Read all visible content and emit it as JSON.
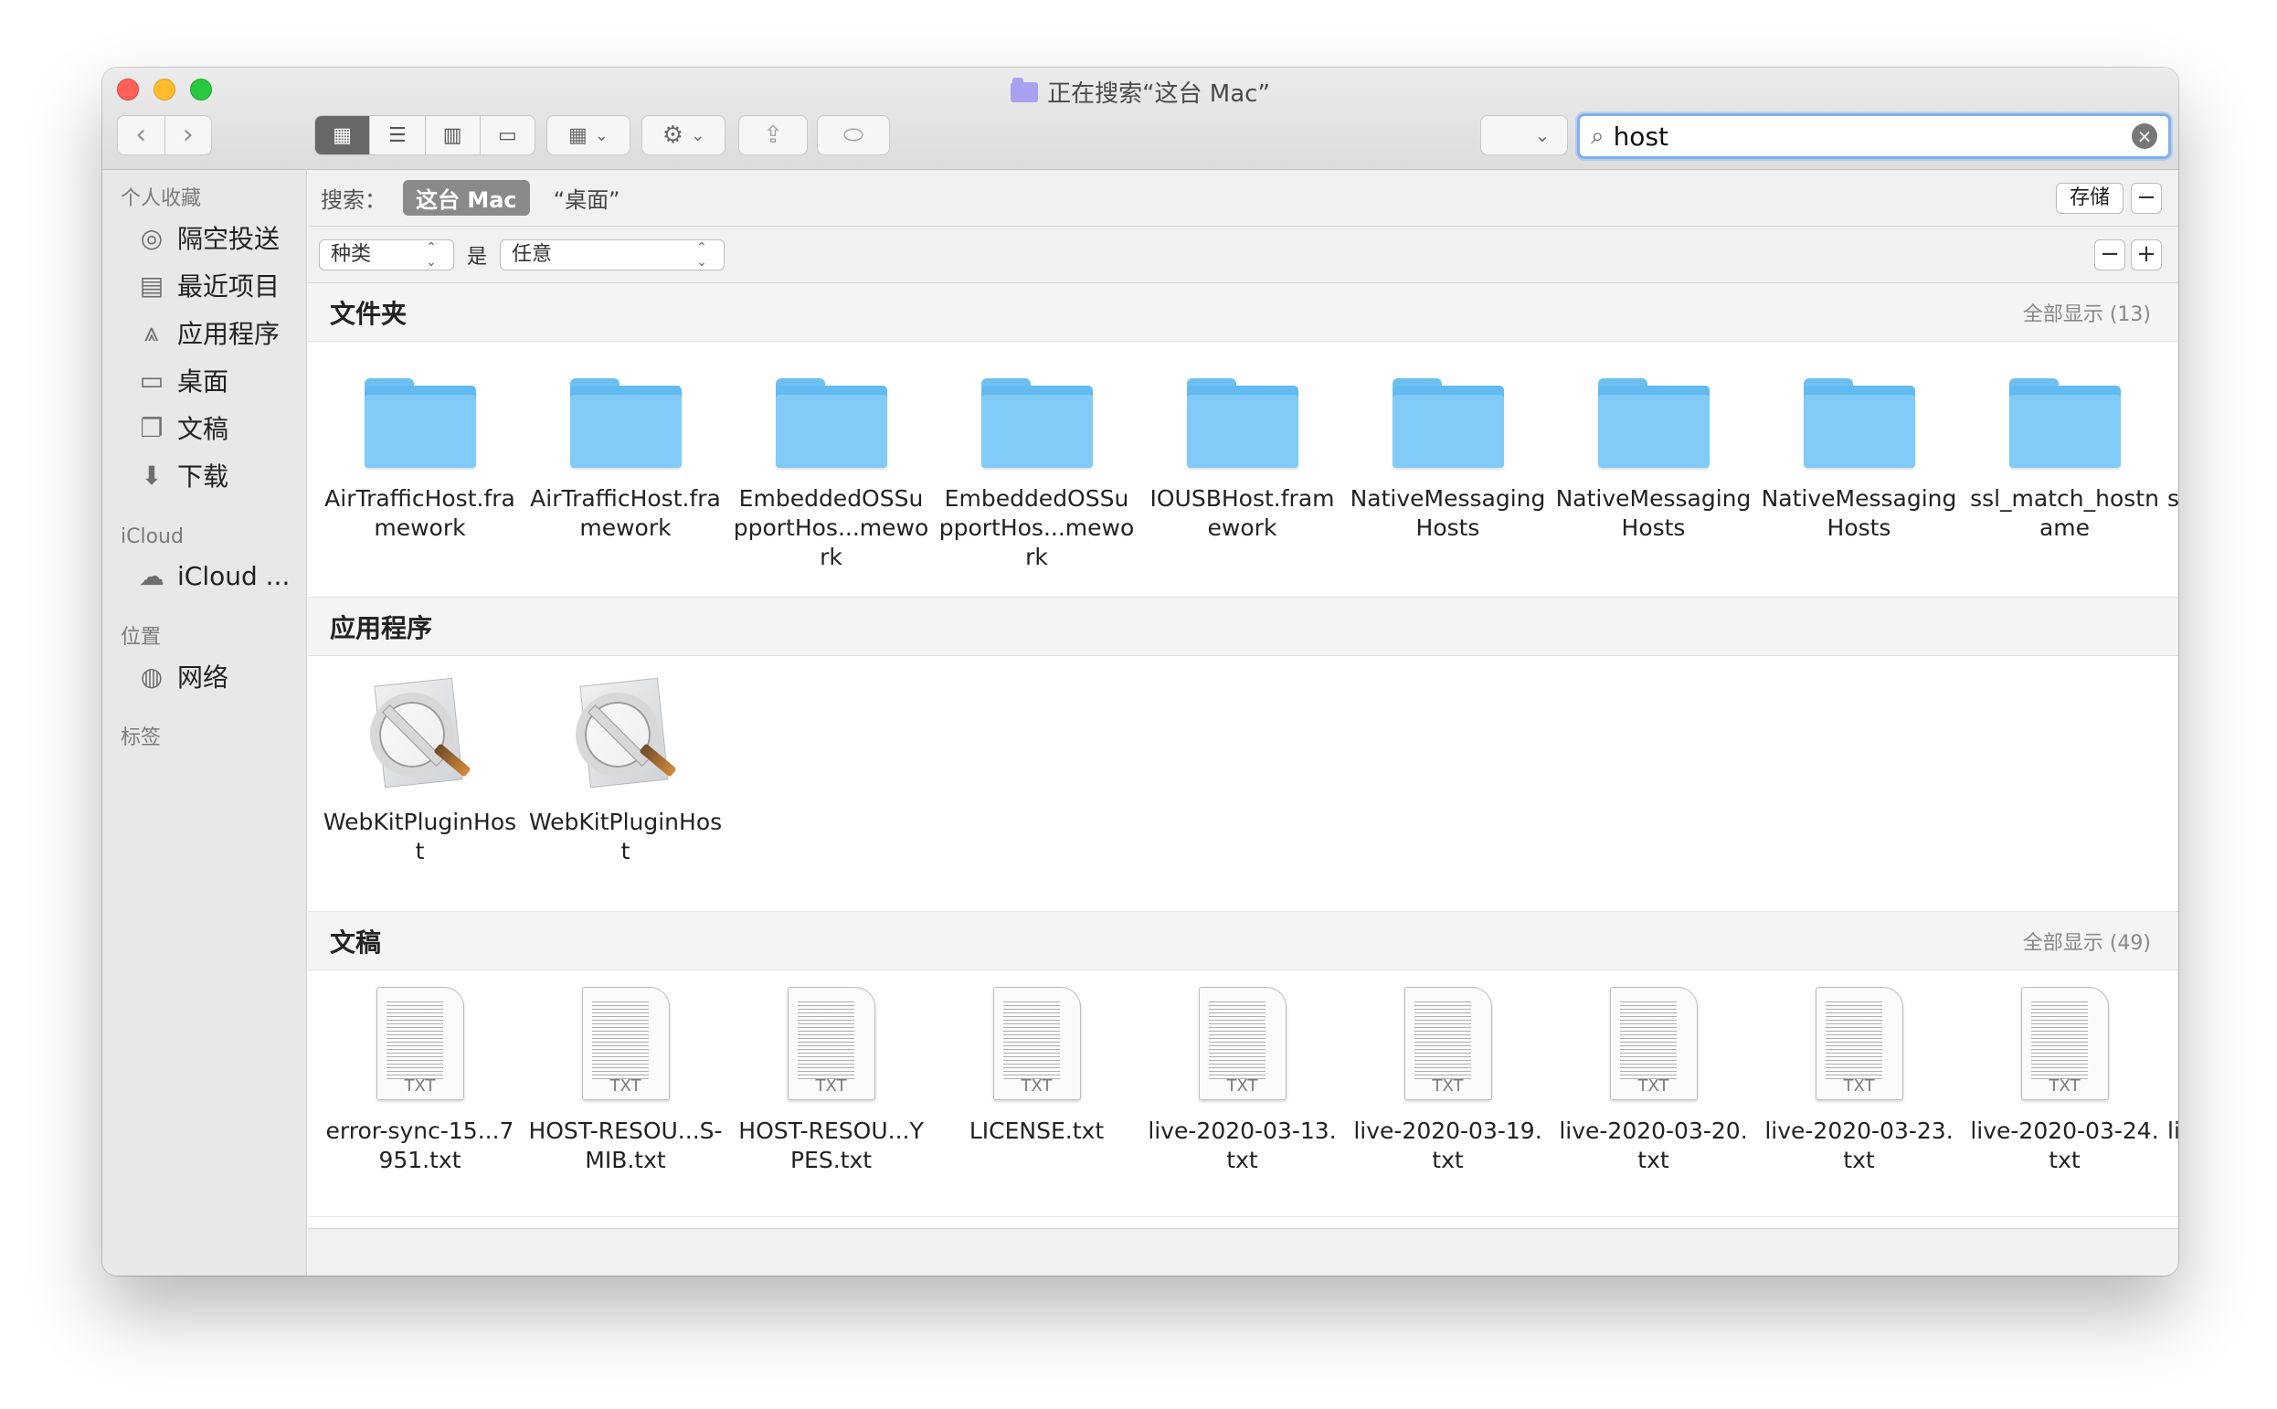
{
  "window": {
    "title": "正在搜索“这台 Mac”"
  },
  "toolbar": {
    "back_icon": "chevron-left-icon",
    "forward_icon": "chevron-right-icon",
    "view_modes": [
      "icon-view",
      "list-view",
      "column-view",
      "gallery-view"
    ],
    "active_view": "icon-view"
  },
  "search": {
    "value": "host"
  },
  "sidebar": {
    "favorites_header": "个人收藏",
    "favorites": [
      {
        "label": "隔空投送",
        "icon": "airdrop-icon"
      },
      {
        "label": "最近项目",
        "icon": "recents-icon"
      },
      {
        "label": "应用程序",
        "icon": "applications-icon"
      },
      {
        "label": "桌面",
        "icon": "desktop-icon"
      },
      {
        "label": "文稿",
        "icon": "documents-icon"
      },
      {
        "label": "下载",
        "icon": "downloads-icon"
      }
    ],
    "icloud_header": "iCloud",
    "icloud": [
      {
        "label": "iCloud ...",
        "icon": "cloud-icon"
      }
    ],
    "locations_header": "位置",
    "locations": [
      {
        "label": "网络",
        "icon": "network-icon"
      }
    ],
    "tags_header": "标签"
  },
  "scope": {
    "label": "搜索：",
    "selected": "这台 Mac",
    "other": "“桌面”",
    "save_label": "存储"
  },
  "rule": {
    "attribute": "种类",
    "operator": "是",
    "value": "任意"
  },
  "sections": {
    "folders": {
      "title": "文件夹",
      "more": "全部显示 (13)",
      "items": [
        "AirTrafficHost.framework",
        "AirTrafficHost.framework",
        "EmbeddedOSSupportHos...mework",
        "EmbeddedOSSupportHos...mework",
        "IOUSBHost.framework",
        "NativeMessagingHosts",
        "NativeMessagingHosts",
        "NativeMessagingHosts",
        "ssl_match_hostname",
        "s"
      ]
    },
    "apps": {
      "title": "应用程序",
      "items": [
        "WebKitPluginHost",
        "WebKitPluginHost"
      ]
    },
    "documents": {
      "title": "文稿",
      "more": "全部显示 (49)",
      "file_badge": "TXT",
      "items": [
        "error-sync-15...7951.txt",
        "HOST-RESOU...S-MIB.txt",
        "HOST-RESOU...YPES.txt",
        "LICENSE.txt",
        "live-2020-03-13.txt",
        "live-2020-03-19.txt",
        "live-2020-03-20.txt",
        "live-2020-03-23.txt",
        "live-2020-03-24.txt",
        "li"
      ]
    }
  }
}
